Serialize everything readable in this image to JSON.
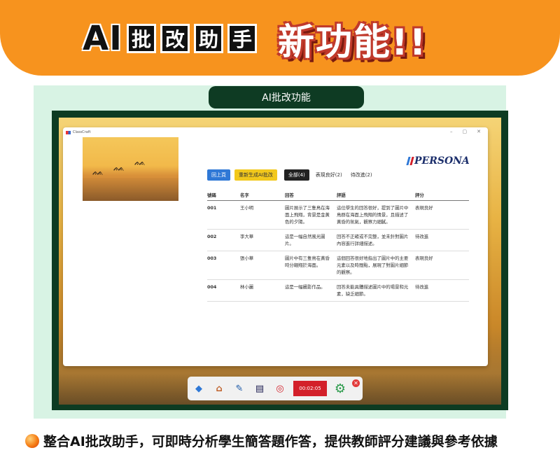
{
  "banner": {
    "ai": "AI",
    "chars": [
      "批",
      "改",
      "助",
      "手"
    ],
    "new_func": "新功能!!"
  },
  "panel_title": "AI批改功能",
  "window": {
    "app_name": "ClassCraft",
    "controls": [
      "–",
      "▢",
      "✕"
    ],
    "brand": "PERSONA",
    "buttons": {
      "back": "回上頁",
      "regen": "重新生成AI批改"
    },
    "filters": {
      "all": "全部(4)",
      "good": "表現良好(2)",
      "improve": "待改進(2)"
    },
    "headers": [
      "號碼",
      "名字",
      "回答",
      "評語",
      "評分"
    ],
    "rows": [
      {
        "num": "001",
        "name": "王小明",
        "answer": "圖片展示了三隻鳥在海面上飛翔，背景是金黃色的夕陽。",
        "comment": "這位學生的回答很好，提到了圖片中鳥群在海面上飛翔的情景，且描述了黃昏的氛氣，觀察力細膩。",
        "grade": "表現良好"
      },
      {
        "num": "002",
        "name": "李大華",
        "answer": "這是一幅自然風光圖片。",
        "comment": "回答不正確或不完整，並未針對圖片內容進行詳細描述。",
        "grade": "待改進"
      },
      {
        "num": "003",
        "name": "張小華",
        "answer": "圖片中有三隻鳥在黃昏時分翱翔於海面。",
        "comment": "這個回答很好地指出了圖片中的主要元素以及時間點，展現了對圖片細節的觀察。",
        "grade": "表現良好"
      },
      {
        "num": "004",
        "name": "林小麗",
        "answer": "這是一幅攝影作品。",
        "comment": "回答未能具體描述圖片中的場景和元素，缺乏細節。",
        "grade": "待改進"
      }
    ]
  },
  "taskbar": {
    "timer": "00:02:05"
  },
  "caption": "整合AI批改助手，可即時分析學生簡答題作答，提供教師評分建議與參考依據"
}
